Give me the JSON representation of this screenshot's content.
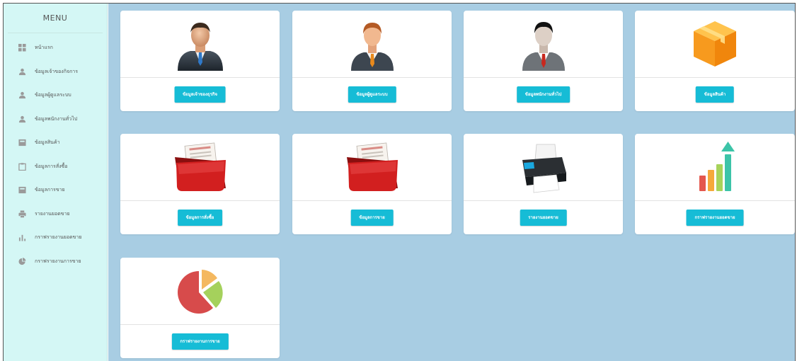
{
  "sidebar": {
    "title": "MENU",
    "items": [
      {
        "label": "หน้าแรก",
        "icon": "dashboard-icon"
      },
      {
        "label": "ข้อมูลเจ้าของกิจการ",
        "icon": "user-icon"
      },
      {
        "label": "ข้อมูลผู้ดูแลระบบ",
        "icon": "user-icon"
      },
      {
        "label": "ข้อมูลพนักงานทั่วไป",
        "icon": "user-icon"
      },
      {
        "label": "ข้อมูลสินค้า",
        "icon": "box-icon"
      },
      {
        "label": "ข้อมูลการสั่งซื้อ",
        "icon": "clipboard-icon"
      },
      {
        "label": "ข้อมูลการขาย",
        "icon": "box-icon"
      },
      {
        "label": "รายงานยอดขาย",
        "icon": "printer-icon"
      },
      {
        "label": "กราฟรายงานยอดขาย",
        "icon": "bar-chart-icon"
      },
      {
        "label": "กราฟรายงานการขาย",
        "icon": "pie-chart-icon"
      }
    ]
  },
  "cards": [
    {
      "label": "ข้อมูลเจ้าของธุรกิจ",
      "icon": "owner-avatar-icon"
    },
    {
      "label": "ข้อมูลผู้ดูแลระบบ",
      "icon": "admin-avatar-icon"
    },
    {
      "label": "ข้อมูลพนักงานทั่วไป",
      "icon": "employee-avatar-icon"
    },
    {
      "label": "ข้อมูลสินค้า",
      "icon": "product-box-icon"
    },
    {
      "label": "ข้อมูลการสั่งซื้อ",
      "icon": "order-folder-icon"
    },
    {
      "label": "ข้อมูลการขาย",
      "icon": "sales-folder-icon"
    },
    {
      "label": "รายงานยอดขาย",
      "icon": "printer-icon"
    },
    {
      "label": "กราฟรายงานยอดขาย",
      "icon": "growth-chart-icon"
    },
    {
      "label": "กราฟรายงานการขาย",
      "icon": "pie-chart-icon"
    }
  ],
  "colors": {
    "sidebar_bg": "#d4f7f5",
    "content_bg": "#a8cde3",
    "button": "#16bcd6"
  }
}
